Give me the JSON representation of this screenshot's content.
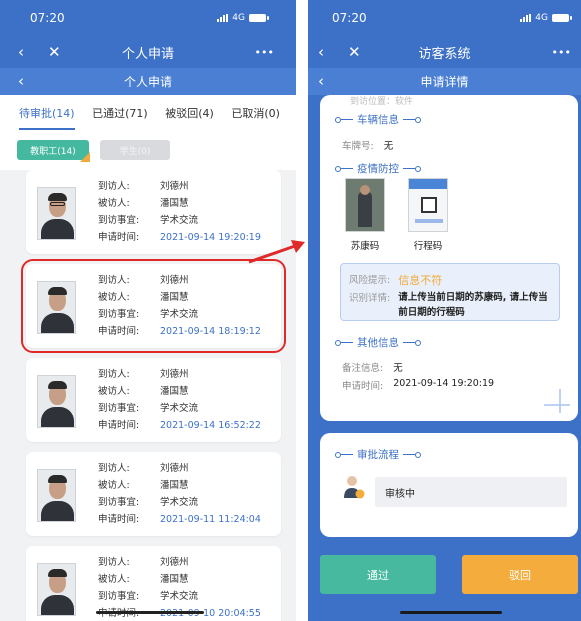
{
  "left": {
    "status": {
      "time": "07:20",
      "network": "4G"
    },
    "nav": {
      "back_icon": "chevron-left-icon",
      "close_icon": "close-icon",
      "title": "个人申请",
      "more": "•••"
    },
    "subnav": {
      "title": "个人申请"
    },
    "tabs": [
      {
        "label": "待审批(14)",
        "active": true
      },
      {
        "label": "已通过(71)",
        "active": false
      },
      {
        "label": "被驳回(4)",
        "active": false
      },
      {
        "label": "已取消(0)",
        "active": false
      }
    ],
    "filters": [
      {
        "label": "教职工(14)",
        "selected": true
      },
      {
        "label": "学生(0)",
        "selected": false
      }
    ],
    "labels": {
      "visitor": "到访人:",
      "visitee": "被访人:",
      "matter": "到访事宜:",
      "time": "申请时间:"
    },
    "records": [
      {
        "visitor": "刘德州",
        "visitee": "潘国慧",
        "matter": "学术交流",
        "time": "2021-09-14 19:20:19",
        "glasses": true
      },
      {
        "visitor": "刘德州",
        "visitee": "潘国慧",
        "matter": "学术交流",
        "time": "2021-09-14 18:19:12",
        "glasses": false
      },
      {
        "visitor": "刘德州",
        "visitee": "潘国慧",
        "matter": "学术交流",
        "time": "2021-09-14 16:52:22",
        "glasses": false
      },
      {
        "visitor": "刘德州",
        "visitee": "潘国慧",
        "matter": "学术交流",
        "time": "2021-09-11 11:24:04",
        "glasses": false
      },
      {
        "visitor": "刘德州",
        "visitee": "潘国慧",
        "matter": "学术交流",
        "time": "2021-09-10 20:04:55",
        "glasses": false
      }
    ]
  },
  "right": {
    "status": {
      "time": "07:20",
      "network": "4G"
    },
    "nav": {
      "title": "访客系统",
      "more": "•••"
    },
    "subnav": {
      "title": "申请详情"
    },
    "cut_text": "到访位置：软件",
    "vehicle": {
      "title": "车辆信息",
      "plate_label": "车牌号:",
      "plate_value": "无"
    },
    "epidemic": {
      "title": "疫情防控",
      "images": [
        {
          "caption": "苏康码"
        },
        {
          "caption": "行程码"
        }
      ],
      "risk_label": "风险提示:",
      "risk_value": "信息不符",
      "detail_label": "识别详情:",
      "detail_value": "请上传当前日期的苏康码, 请上传当前日期的行程码"
    },
    "other": {
      "title": "其他信息",
      "remark_label": "备注信息:",
      "remark_value": "无",
      "time_label": "申请时间:",
      "time_value": "2021-09-14 19:20:19"
    },
    "approval": {
      "title": "审批流程",
      "step": "审核中"
    },
    "buttons": {
      "pass": "通过",
      "reject": "驳回"
    }
  },
  "colors": {
    "primary": "#3d71c7",
    "success": "#47b99f",
    "warning": "#f4ad3c",
    "highlight": "#e02a2a"
  }
}
